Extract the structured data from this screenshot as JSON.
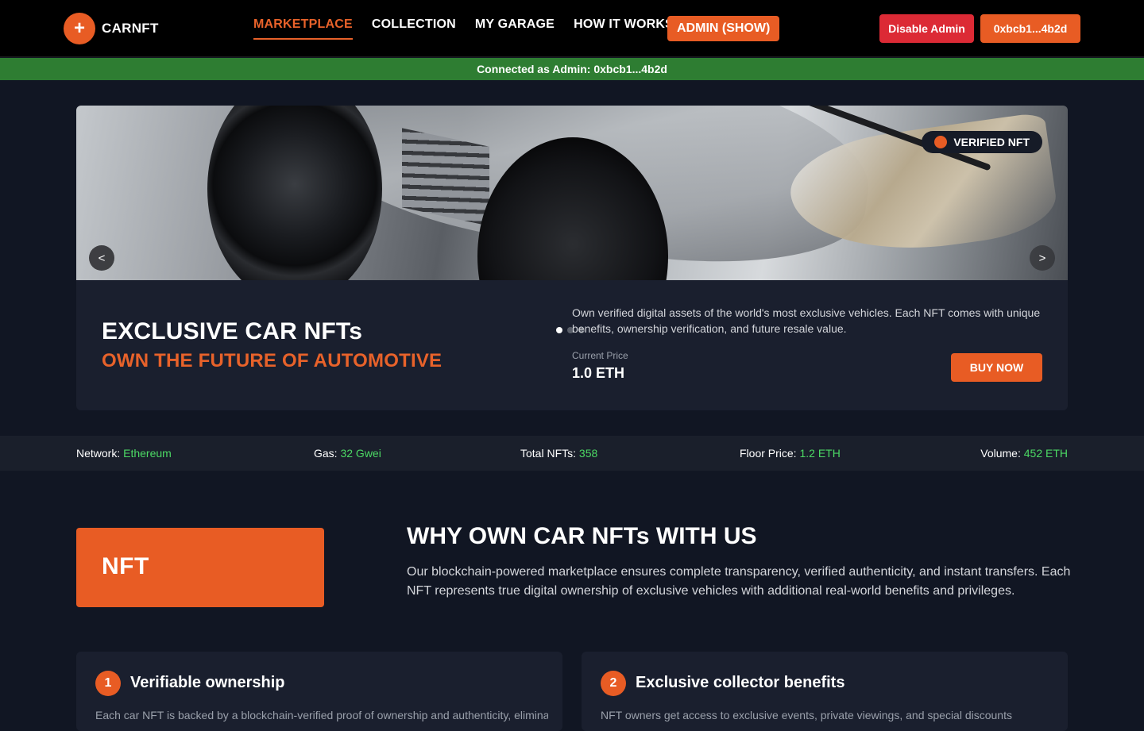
{
  "header": {
    "logo_glyph": "+",
    "brand": "CARNFT",
    "nav": [
      {
        "label": "MARKETPLACE",
        "active": true
      },
      {
        "label": "COLLECTION",
        "active": false
      },
      {
        "label": "MY GARAGE",
        "active": false
      },
      {
        "label": "HOW IT WORKS",
        "active": false
      }
    ],
    "admin_toggle": "ADMIN (SHOW)",
    "disable_admin": "Disable Admin",
    "wallet": "0xbcb1...4b2d"
  },
  "admin_bar": {
    "text": "Connected as Admin: 0xbcb1...4b2d",
    "color": "#2e7d32"
  },
  "hero": {
    "badge": "VERIFIED NFT",
    "prev": "<",
    "next": ">",
    "title": "EXCLUSIVE CAR NFTs",
    "subtitle": "OWN THE FUTURE OF AUTOMOTIVE",
    "description": "Own verified digital assets of the world's most exclusive vehicles. Each NFT comes with unique benefits, ownership verification, and future resale value.",
    "price_label": "Current Price",
    "price": "1.0 ETH",
    "buy_label": "BUY NOW",
    "slides": 3,
    "active_slide": 0
  },
  "stats": {
    "network": {
      "label": "Network:",
      "value": "Ethereum"
    },
    "gas": {
      "label": "Gas:",
      "value": "32 Gwei"
    },
    "total": {
      "label": "Total NFTs:",
      "value": "358"
    },
    "floor": {
      "label": "Floor Price:",
      "value": "1.2 ETH"
    },
    "volume": {
      "label": "Volume:",
      "value": "452 ETH"
    }
  },
  "why": {
    "block_label": "NFT",
    "title": "WHY OWN CAR NFTs WITH US",
    "description": "Our blockchain-powered marketplace ensures complete transparency, verified authenticity, and instant transfers. Each NFT represents true digital ownership of exclusive vehicles with additional real-world benefits and privileges.",
    "cards": [
      {
        "num": "1",
        "title": "Verifiable ownership",
        "body": "Each car NFT is backed by a blockchain-verified proof of ownership and authenticity, eliminating"
      },
      {
        "num": "2",
        "title": "Exclusive collector benefits",
        "body": "NFT owners get access to exclusive events, private viewings, and special discounts"
      }
    ]
  },
  "colors": {
    "accent": "#e85c24",
    "danger": "#dc2a35",
    "positive": "#4cd964",
    "background": "#111623"
  }
}
